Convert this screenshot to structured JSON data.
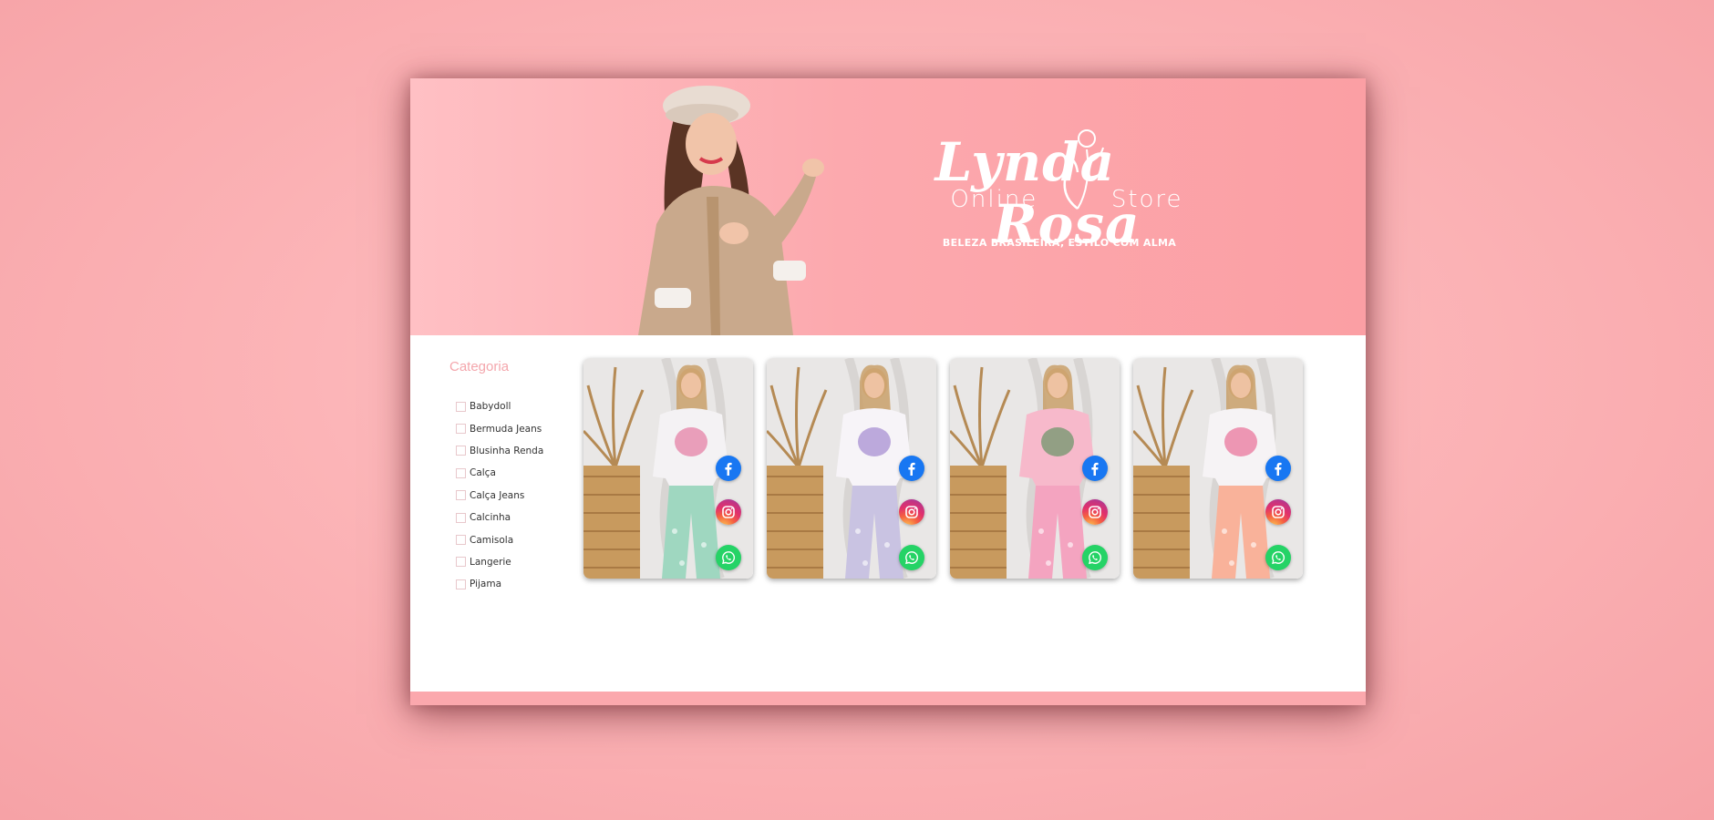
{
  "store": {
    "name_left": "Lynda",
    "name_right": "Rosa",
    "subtitle_left": "Online",
    "subtitle_right": "Store",
    "tagline": "BELEZA BRASILEIRA, ESTILO COM ALMA"
  },
  "sidebar": {
    "title": "Categoria",
    "categories": [
      {
        "label": "Babydoll",
        "checked": false
      },
      {
        "label": "Bermuda Jeans",
        "checked": false
      },
      {
        "label": "Blusinha Renda",
        "checked": false
      },
      {
        "label": "Calça",
        "checked": false
      },
      {
        "label": "Calça Jeans",
        "checked": false
      },
      {
        "label": "Calcinha",
        "checked": false
      },
      {
        "label": "Camisola",
        "checked": false
      },
      {
        "label": "Langerie",
        "checked": false
      },
      {
        "label": "Pijama",
        "checked": false
      }
    ]
  },
  "products": [
    {
      "top_color": "#f4f2f4",
      "pants_color": "#9fd7c0",
      "print_color": "#e05a8a"
    },
    {
      "top_color": "#f7f4f8",
      "pants_color": "#c9c3e2",
      "print_color": "#8d6bc4"
    },
    {
      "top_color": "#f7b9cb",
      "pants_color": "#f4a4c0",
      "print_color": "#3f8a4a"
    },
    {
      "top_color": "#f6f3f5",
      "pants_color": "#f9b29a",
      "print_color": "#e6497c"
    }
  ],
  "social_icons": [
    "facebook-icon",
    "instagram-icon",
    "whatsapp-icon"
  ],
  "colors": {
    "accent_pink": "#fba8ad",
    "category_title": "#f4a6ac",
    "facebook": "#1877f2",
    "whatsapp": "#25d366"
  }
}
